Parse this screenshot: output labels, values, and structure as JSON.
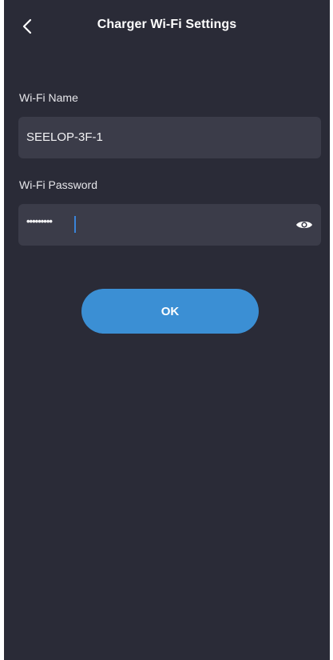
{
  "header": {
    "title": "Charger Wi-Fi Settings",
    "back_icon": "chevron-left-icon"
  },
  "form": {
    "wifi_name_label": "Wi-Fi Name",
    "wifi_name_value": "SEELOP-3F-1",
    "wifi_password_label": "Wi-Fi Password",
    "wifi_password_value": "•••••••••",
    "show_password_icon": "eye-icon"
  },
  "actions": {
    "ok_label": "OK"
  },
  "colors": {
    "background": "#2a2b37",
    "field_background": "#3b3c49",
    "accent": "#3b8fd4",
    "caret": "#3a84d8"
  }
}
